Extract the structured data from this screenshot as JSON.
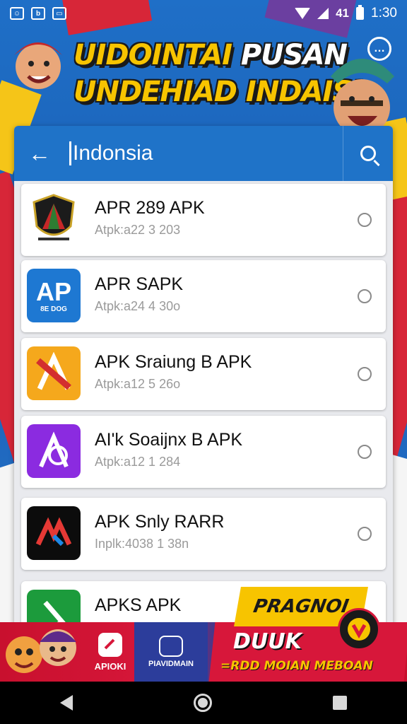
{
  "status_bar": {
    "icons_left": [
      "people-icon",
      "file-icon",
      "image-icon"
    ],
    "signal_text": "41",
    "time": "1:30"
  },
  "banner": {
    "line1_part1": "UIDOINTAI",
    "line1_part2": "PUSAN",
    "line2": "UNDEHIAD INDAISI"
  },
  "search": {
    "query": "Indonsia"
  },
  "apps": [
    {
      "name": "APR 289 APK",
      "sub": "Atpk:a22 3 203",
      "icon": "shield-logo"
    },
    {
      "name": "APR SAPK",
      "sub": "Atpk:a24 4 30o",
      "icon": "ap-logo",
      "icon_text": "AP",
      "icon_caption": "8E DOG"
    },
    {
      "name": "APK Sraiung B APK",
      "sub": "Atpk:a12 5 26o",
      "icon": "slash-logo"
    },
    {
      "name": "AI'k Soaijnx B APK",
      "sub": "Atpk:a12 1 284",
      "icon": "purple-a-logo"
    },
    {
      "name": "APK Snly RARR",
      "sub": "Inplk:4038 1 38n",
      "icon": "red-m-logo"
    },
    {
      "name": "APKS APK",
      "sub": "",
      "icon": "green-logo"
    }
  ],
  "promo": {
    "apk_label": "APIOKI",
    "mid_label": "PIAVIDMAIN",
    "tag": "PRAGNOI",
    "big": "DUUK",
    "sub": "=RDD MOIAN MEBOAN"
  },
  "colors": {
    "header_blue": "#1f73c8",
    "banner_yellow": "#f7c400",
    "flag_red": "#d7173a"
  }
}
